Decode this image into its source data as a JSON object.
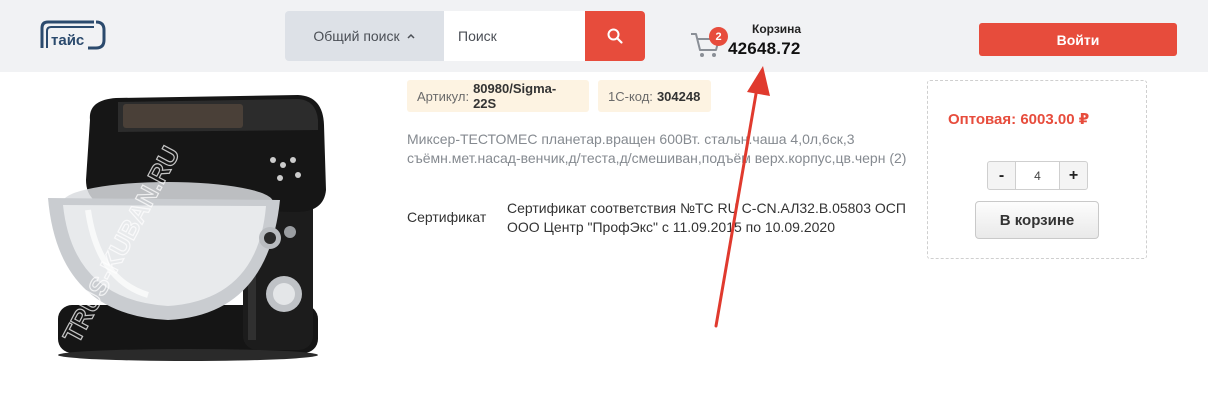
{
  "header": {
    "logo_alt": "логотип",
    "search": {
      "scope_label": "Общий поиск",
      "placeholder": "Поиск"
    },
    "cart": {
      "label": "Корзина",
      "count": "2",
      "total": "42648.72"
    },
    "login_label": "Войти"
  },
  "product": {
    "sku_label": "Артикул:",
    "sku_value": "80980/Sigma-22S",
    "code_label": "1С-код:",
    "code_value": "304248",
    "description": "Миксер-ТЕСТОМЕС планетар.вращен 600Вт. стальн.чаша 4,0л,6ск,3 съёмн.мет.насад-венчик,д/теста,д/смешиван,подъём верх.корпус,цв.черн (2)",
    "certificate_label": "Сертификат",
    "certificate_text": "Сертификат соответствия №ТС RU C-CN.АЛ32.В.05803 ОСП ООО Центр \"ПрофЭкс\" с 11.09.2015 по 10.09.2020",
    "image_watermark": "TRUS-KUBAN.RU"
  },
  "purchase": {
    "price_label": "Оптовая: 6003.00 ₽",
    "quantity": "4",
    "minus_label": "-",
    "plus_label": "+",
    "cart_state_label": "В корзине"
  },
  "colors": {
    "accent": "#e74c3c",
    "header_bg": "#f1f2f4",
    "tag_bg": "#fdf3e2"
  }
}
